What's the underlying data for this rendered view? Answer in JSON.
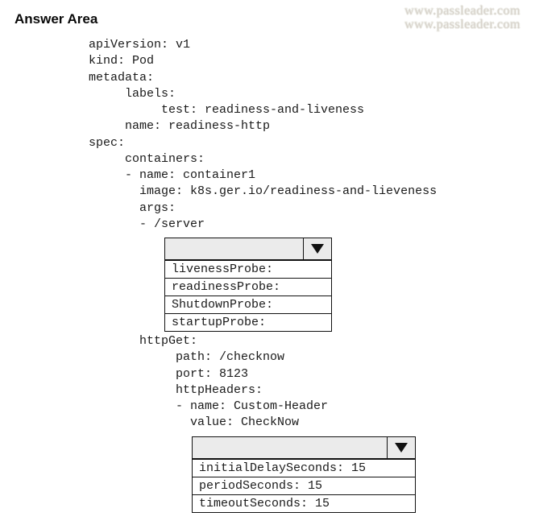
{
  "title": "Answer Area",
  "watermark": {
    "line1": "www.passleader.com",
    "line2": "www.passleader.com"
  },
  "yaml": {
    "block1": "apiVersion: v1\nkind: Pod\nmetadata:\n     labels:\n          test: readiness-and-liveness\n     name: readiness-http\nspec:\n     containers:\n     - name: container1\n       image: k8s.ger.io/readiness-and-lieveness\n       args:\n       - /server",
    "block2": "       httpGet:\n            path: /checknow\n            port: 8123\n            httpHeaders:\n            - name: Custom-Header\n              value: CheckNow"
  },
  "dropdown1": {
    "options": [
      "livenessProbe:",
      "readinessProbe:",
      "ShutdownProbe:",
      "startupProbe:"
    ]
  },
  "dropdown2": {
    "options": [
      "initialDelaySeconds: 15",
      "periodSeconds: 15",
      "timeoutSeconds: 15"
    ]
  }
}
